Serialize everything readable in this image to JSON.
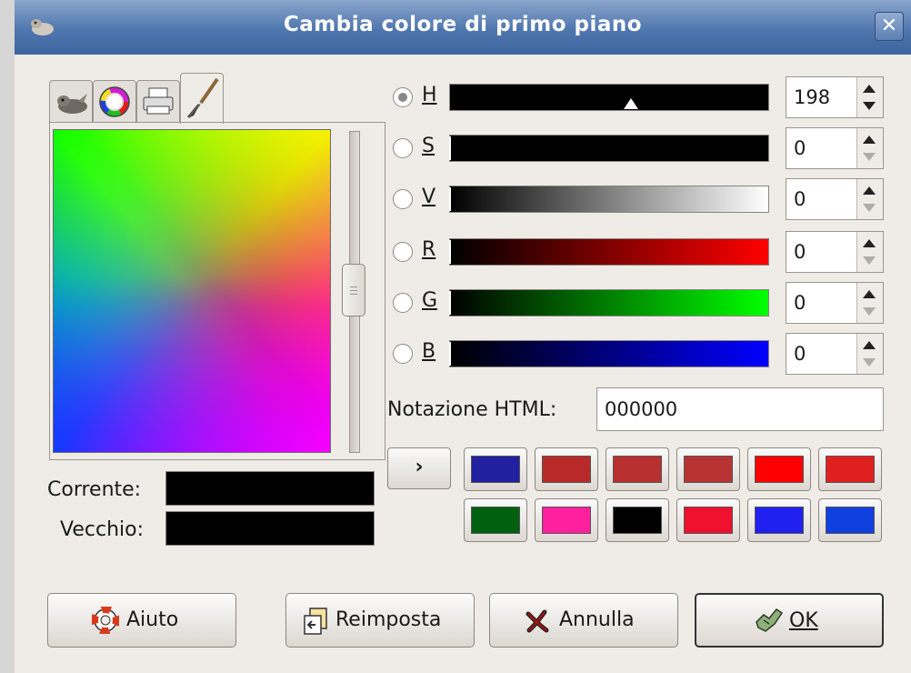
{
  "window": {
    "title": "Cambia colore di primo piano",
    "close_glyph": "✕"
  },
  "tabs": [
    {
      "name": "gimp-selector",
      "icon": "wilber-icon"
    },
    {
      "name": "wheel-selector",
      "icon": "color-wheel-icon"
    },
    {
      "name": "cmyk-selector",
      "icon": "printer-icon"
    },
    {
      "name": "watercolor-selector",
      "icon": "brush-icon"
    }
  ],
  "channels": [
    {
      "label": "H",
      "value": "198",
      "selected": true,
      "down_disabled": false
    },
    {
      "label": "S",
      "value": "0",
      "selected": false,
      "down_disabled": true
    },
    {
      "label": "V",
      "value": "0",
      "selected": false,
      "down_disabled": true
    },
    {
      "label": "R",
      "value": "0",
      "selected": false,
      "down_disabled": true
    },
    {
      "label": "G",
      "value": "0",
      "selected": false,
      "down_disabled": true
    },
    {
      "label": "B",
      "value": "0",
      "selected": false,
      "down_disabled": true
    }
  ],
  "html_notation": {
    "label": "Notazione HTML:",
    "value": "000000"
  },
  "current": {
    "label": "Corrente:",
    "color": "#000000"
  },
  "old": {
    "label": "Vecchio:",
    "color": "#000000"
  },
  "history_button": "›",
  "history": [
    "#2020a0",
    "#b82a2a",
    "#b83030",
    "#b83434",
    "#ff0000",
    "#e02020",
    "#006010",
    "#ff20a0",
    "#000000",
    "#f01030",
    "#2020f0",
    "#1040e0"
  ],
  "buttons": {
    "help": "Aiuto",
    "reset": "Reimposta",
    "cancel": "Annulla",
    "ok": "OK"
  }
}
